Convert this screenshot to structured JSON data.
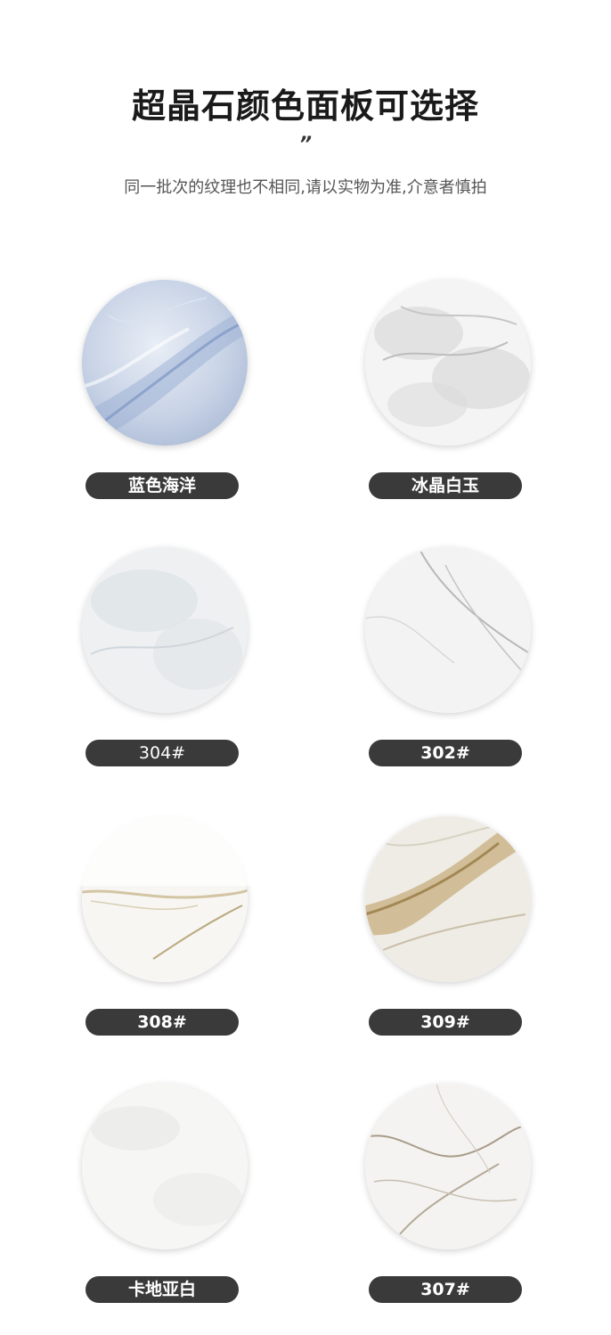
{
  "header": {
    "title": "超晶石颜色面板可选择",
    "quote_mark": "”",
    "subtitle": "同一批次的纹理也不相同,请以实物为准,介意者慎拍"
  },
  "swatches": [
    {
      "label": "蓝色海洋",
      "texture": "blue-marble"
    },
    {
      "label": "冰晶白玉",
      "texture": "grey-cloud-marble"
    },
    {
      "label": "304#",
      "texture": "soft-white-marble"
    },
    {
      "label": "302#",
      "texture": "white-marble-fine-veins"
    },
    {
      "label": "308#",
      "texture": "white-marble-gold-streak"
    },
    {
      "label": "309#",
      "texture": "gold-vein-marble"
    },
    {
      "label": "卡地亚白",
      "texture": "plain-white-marble"
    },
    {
      "label": "307#",
      "texture": "white-marble-brown-veins"
    }
  ]
}
